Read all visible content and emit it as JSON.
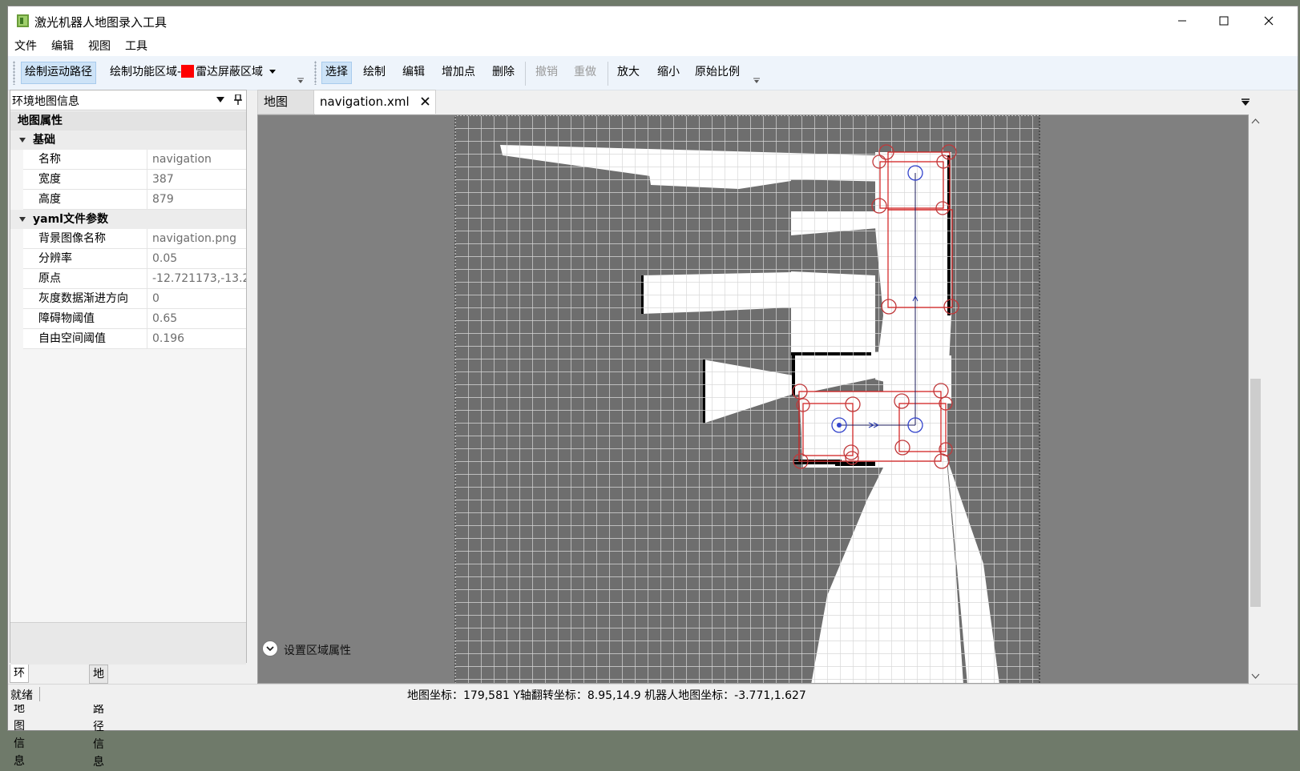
{
  "window": {
    "title": "激光机器人地图录入工具"
  },
  "menu": [
    "文件",
    "编辑",
    "视图",
    "工具"
  ],
  "toolbar": {
    "draw_path": "绘制运动路径",
    "draw_region": "绘制功能区域-",
    "region_type": "雷达屏蔽区域",
    "region_color": "#ff0000",
    "select": "选择",
    "draw": "绘制",
    "edit": "编辑",
    "add_point": "增加点",
    "delete": "删除",
    "undo": "撤销",
    "redo": "重做",
    "zoom_in": "放大",
    "zoom_out": "缩小",
    "original_scale": "原始比例"
  },
  "left_panel": {
    "title": "环境地图信息",
    "category": "地图属性",
    "group_basic": "基础",
    "name_label": "名称",
    "name_value": "navigation",
    "width_label": "宽度",
    "width_value": "387",
    "height_label": "高度",
    "height_value": "879",
    "group_yaml": "yaml文件参数",
    "bg_label": "背景图像名称",
    "bg_value": "navigation.png",
    "res_label": "分辨率",
    "res_value": "0.05",
    "origin_label": "原点",
    "origin_value": "-12.721173,-13.2",
    "negate_label": "灰度数据渐进方向",
    "negate_value": "0",
    "occ_label": "障碍物阈值",
    "occ_value": "0.65",
    "free_label": "自由空间阈值",
    "free_value": "0.196"
  },
  "bottom_tabs": {
    "env": "环境地图信息",
    "path": "地图路径信息"
  },
  "doc_tabs": {
    "map": "地图",
    "file": "navigation.xml"
  },
  "canvas": {
    "area_props": "设置区域属性"
  },
  "status": {
    "ready": "就绪",
    "coords": "地图坐标：179,581  Y轴翻转坐标：8.95,14.9  机器人地图坐标：-3.771,1.627"
  }
}
